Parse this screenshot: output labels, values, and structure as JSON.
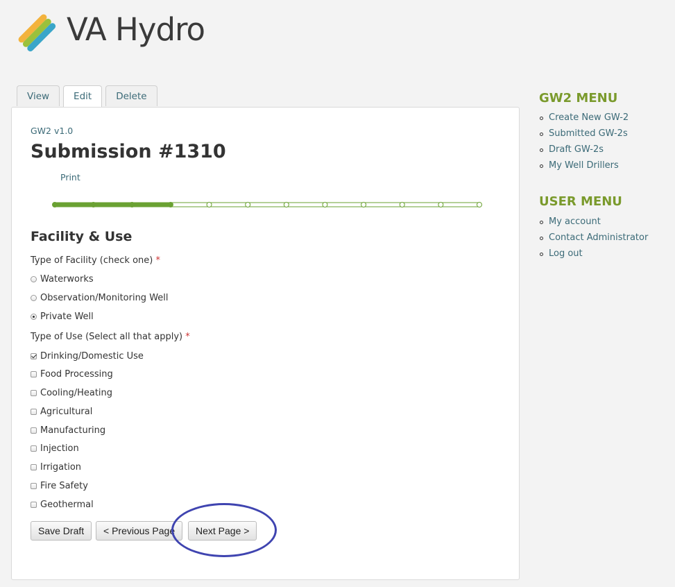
{
  "site": {
    "name": "VA Hydro"
  },
  "tabs": [
    {
      "label": "View",
      "active": false
    },
    {
      "label": "Edit",
      "active": true
    },
    {
      "label": "Delete",
      "active": false
    }
  ],
  "main": {
    "form_version": "GW2 v1.0",
    "title": "Submission #1310",
    "print_label": "Print",
    "progress": {
      "total_steps": 12,
      "completed_steps": 4,
      "color": "#6aa132"
    },
    "section_title": "Facility & Use",
    "facility": {
      "label": "Type of Facility (check one)",
      "required_mark": "*",
      "options": [
        {
          "label": "Waterworks",
          "checked": false
        },
        {
          "label": "Observation/Monitoring Well",
          "checked": false
        },
        {
          "label": "Private Well",
          "checked": true
        }
      ]
    },
    "use": {
      "label": "Type of Use (Select all that apply)",
      "required_mark": "*",
      "options": [
        {
          "label": "Drinking/Domestic Use",
          "checked": true
        },
        {
          "label": "Food Processing",
          "checked": false
        },
        {
          "label": "Cooling/Heating",
          "checked": false
        },
        {
          "label": "Agricultural",
          "checked": false
        },
        {
          "label": "Manufacturing",
          "checked": false
        },
        {
          "label": "Injection",
          "checked": false
        },
        {
          "label": "Irrigation",
          "checked": false
        },
        {
          "label": "Fire Safety",
          "checked": false
        },
        {
          "label": "Geothermal",
          "checked": false
        }
      ]
    },
    "buttons": {
      "save_draft": "Save Draft",
      "previous": "< Previous Page",
      "next": "Next Page >"
    }
  },
  "sidebar": {
    "gw2_menu": {
      "title": "GW2 MENU",
      "items": [
        "Create New GW-2",
        "Submitted GW-2s",
        "Draft GW-2s",
        "My Well Drillers"
      ]
    },
    "user_menu": {
      "title": "USER MENU",
      "items": [
        "My account",
        "Contact Administrator",
        "Log out"
      ]
    }
  },
  "colors": {
    "link": "#3b6a77",
    "accent_green": "#7a9a2c",
    "annotation_circle": "#3f44b0"
  }
}
